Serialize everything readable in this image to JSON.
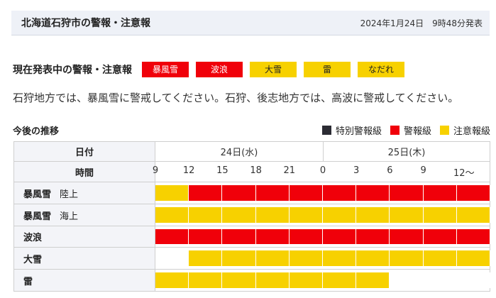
{
  "header": {
    "title": "北海道石狩市の警報・注意報",
    "date": "2024年1月24日　9時48分発表"
  },
  "current": {
    "title": "現在発表中の警報・注意報",
    "tags": [
      {
        "label": "暴風雪",
        "level": "warning"
      },
      {
        "label": "波浪",
        "level": "warning"
      },
      {
        "label": "大雪",
        "level": "advisory"
      },
      {
        "label": "雷",
        "level": "advisory"
      },
      {
        "label": "なだれ",
        "level": "advisory"
      }
    ]
  },
  "message": "石狩地方では、暴風雪に警戒してください。石狩、後志地方では、高波に警戒してください。",
  "trend": {
    "title": "今後の推移",
    "legend": [
      {
        "label": "特別警報級",
        "color": "#2b2b33"
      },
      {
        "label": "警報級",
        "color": "#f0000a"
      },
      {
        "label": "注意報級",
        "color": "#f7d100"
      }
    ]
  },
  "table": {
    "date_label": "日付",
    "time_label": "時間",
    "dates": [
      "24日(水)",
      "25日(木)"
    ],
    "times": [
      "9",
      "12",
      "15",
      "18",
      "21",
      "0",
      "3",
      "6",
      "9",
      "12〜"
    ],
    "colors": {
      "warning": "#f0000a",
      "advisory": "#f7d100"
    },
    "rows": [
      {
        "name": "暴風雪",
        "sub": "陸上",
        "levels": [
          "advisory",
          "warning",
          "warning",
          "warning",
          "warning",
          "warning",
          "warning",
          "warning",
          "warning",
          "warning"
        ]
      },
      {
        "name": "暴風雪",
        "sub": "海上",
        "levels": [
          "advisory",
          "advisory",
          "advisory",
          "advisory",
          "advisory",
          "advisory",
          "advisory",
          "advisory",
          "advisory",
          "advisory"
        ]
      },
      {
        "name": "波浪",
        "sub": "",
        "levels": [
          "warning",
          "warning",
          "warning",
          "warning",
          "warning",
          "warning",
          "warning",
          "warning",
          "warning",
          "warning"
        ]
      },
      {
        "name": "大雪",
        "sub": "",
        "levels": [
          "none",
          "advisory",
          "advisory",
          "advisory",
          "advisory",
          "advisory",
          "advisory",
          "advisory",
          "advisory",
          "advisory"
        ]
      },
      {
        "name": "雷",
        "sub": "",
        "levels": [
          "advisory",
          "advisory",
          "advisory",
          "advisory",
          "advisory",
          "advisory",
          "advisory",
          "none",
          "none",
          "none"
        ]
      }
    ]
  }
}
